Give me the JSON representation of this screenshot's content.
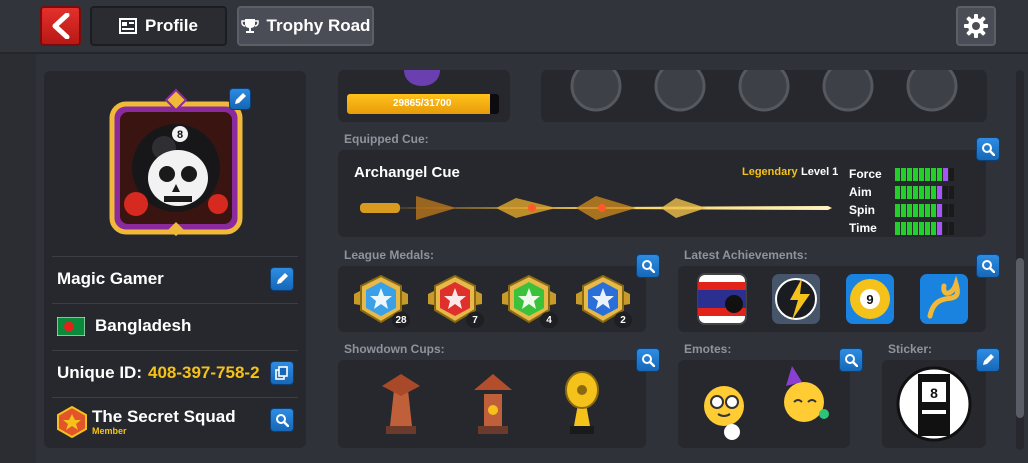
{
  "header": {
    "tabs": [
      {
        "label": "Profile"
      },
      {
        "label": "Trophy Road"
      }
    ]
  },
  "profile": {
    "name": "Magic Gamer",
    "country": "Bangladesh",
    "unique_id_label": "Unique ID:",
    "unique_id": "408-397-758-2",
    "club_name": "The Secret Squad",
    "club_role": "Member"
  },
  "xp": {
    "text": "29865/31700",
    "progress": 0.942
  },
  "cue": {
    "section_label": "Equipped Cue:",
    "name": "Archangel Cue",
    "rarity": "Legendary",
    "level": "Level 1",
    "stats": [
      {
        "label": "Force",
        "filled": 9,
        "max": 10
      },
      {
        "label": "Aim",
        "filled": 8,
        "max": 10
      },
      {
        "label": "Spin",
        "filled": 8,
        "max": 10
      },
      {
        "label": "Time",
        "filled": 8,
        "max": 10
      }
    ]
  },
  "league": {
    "section_label": "League Medals:",
    "medals": [
      {
        "icon": "blue-star-medal-icon",
        "count": "28",
        "color": "#3aa0e8"
      },
      {
        "icon": "red-star-medal-icon",
        "count": "7",
        "color": "#e0302c"
      },
      {
        "icon": "green-star-medal-icon",
        "count": "4",
        "color": "#3cc23a"
      },
      {
        "icon": "dark-blue-star-medal-icon",
        "count": "2",
        "color": "#2a6fd8"
      }
    ]
  },
  "achievements": {
    "section_label": "Latest Achievements:"
  },
  "showdown": {
    "section_label": "Showdown Cups:"
  },
  "emotes": {
    "section_label": "Emotes:"
  },
  "sticker": {
    "section_label": "Sticker:"
  },
  "colors": {
    "gold": "#f5c21b",
    "accent_blue": "#1f7fd6",
    "stat_green": "#22d02a",
    "stat_purple": "#a855f7"
  }
}
